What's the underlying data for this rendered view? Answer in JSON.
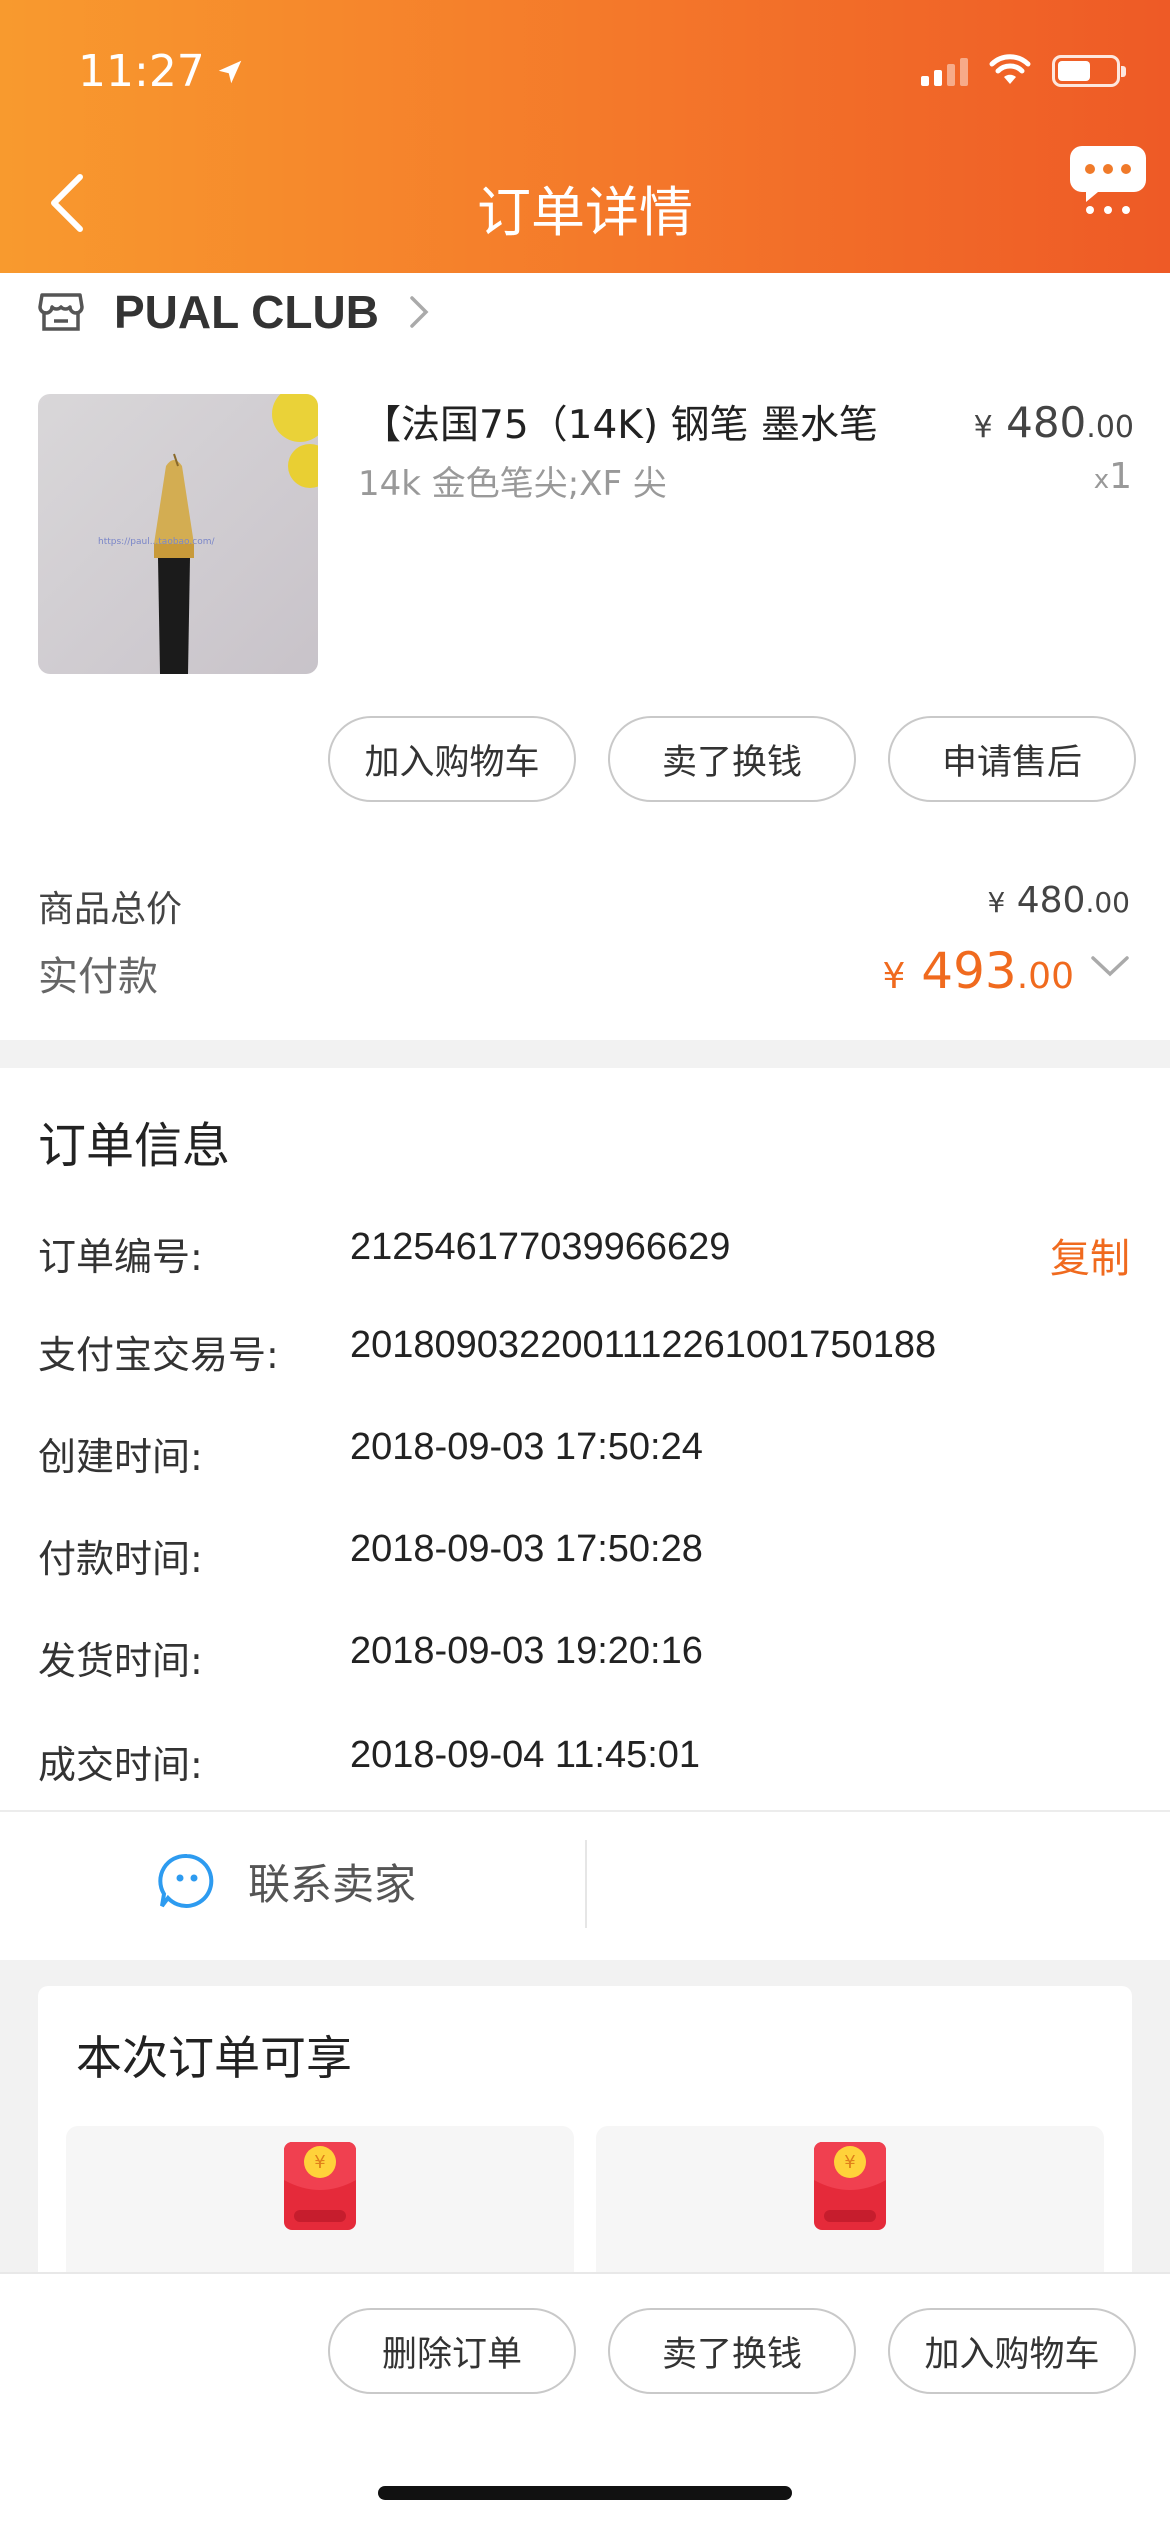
{
  "status_bar": {
    "time": "11:27",
    "location_icon": "location-arrow-icon",
    "signal_icon": "signal-icon",
    "wifi_icon": "wifi-icon",
    "battery_icon": "battery-icon",
    "battery_level": 0.5
  },
  "nav": {
    "back_icon": "chevron-left-icon",
    "title": "订单详情",
    "more_icon": "chat-more-icon"
  },
  "shop": {
    "icon": "store-icon",
    "name": "PUAL CLUB",
    "chevron_icon": "chevron-right-icon"
  },
  "product": {
    "title": "【法国75（14K) 钢笔 墨水笔",
    "spec": "14k 金色笔尖;XF 尖",
    "price_symbol": "¥",
    "price_int": "480",
    "price_dec": ".00",
    "qty_prefix": "x",
    "qty": "1",
    "actions": [
      "加入购物车",
      "卖了换钱",
      "申请售后"
    ]
  },
  "totals": {
    "goods_label": "商品总价",
    "goods_symbol": "¥",
    "goods_int": "480",
    "goods_dec": ".00",
    "paid_label": "实付款",
    "paid_symbol": "¥",
    "paid_int": "493",
    "paid_dec": ".00",
    "expand_icon": "chevron-down-icon"
  },
  "order_info": {
    "title": "订单信息",
    "copy_label": "复制",
    "rows": [
      {
        "label": "订单编号:",
        "value": "212546177039966629"
      },
      {
        "label": "支付宝交易号:",
        "value": "2018090322001112261001750188"
      },
      {
        "label": "创建时间:",
        "value": "2018-09-03 17:50:24"
      },
      {
        "label": "付款时间:",
        "value": "2018-09-03 17:50:28"
      },
      {
        "label": "发货时间:",
        "value": "2018-09-03 19:20:16"
      },
      {
        "label": "成交时间:",
        "value": "2018-09-04 11:45:01"
      }
    ]
  },
  "contact": {
    "icon": "chat-smile-icon",
    "label": "联系卖家"
  },
  "benefits": {
    "title": "本次订单可享",
    "coupons": [
      {
        "icon": "red-packet-icon"
      },
      {
        "icon": "red-packet-icon"
      }
    ]
  },
  "bottom_actions": [
    "删除订单",
    "卖了换钱",
    "加入购物车"
  ],
  "colors": {
    "accent": "#f06a1e",
    "header_start": "#f89a2e",
    "header_end": "#ee5a26"
  }
}
